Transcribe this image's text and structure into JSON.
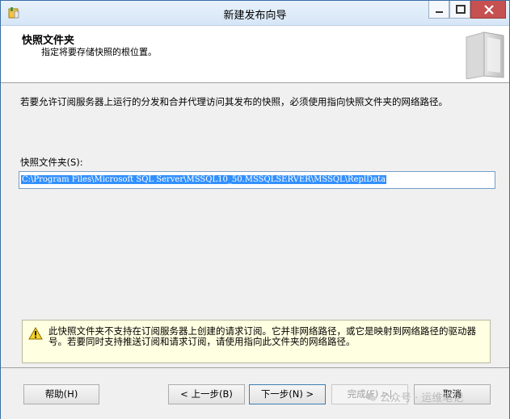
{
  "window": {
    "title": "新建发布向导"
  },
  "header": {
    "title": "快照文件夹",
    "description": "指定将要存储快照的根位置。"
  },
  "content": {
    "intro": "若要允许订阅服务器上运行的分发和合并代理访问其发布的快照，必须使用指向快照文件夹的网络路径。",
    "folder_label": "快照文件夹(S):",
    "folder_value": "C:\\Program Files\\Microsoft SQL Server\\MSSQL10_50.MSSQLSERVER\\MSSQL\\ReplData"
  },
  "warning": {
    "icon": "warning-icon",
    "text": "此快照文件夹不支持在订阅服务器上创建的请求订阅。它并非网络路径，或它是映射到网络路径的驱动器号。若要同时支持推送订阅和请求订阅，请使用指向此文件夹的网络路径。"
  },
  "buttons": {
    "help": "帮助(H)",
    "prev": "< 上一步(B)",
    "next": "下一步(N) >",
    "finish": "完成(F) >|",
    "cancel": "取消"
  },
  "watermark": {
    "text": "公众号 · 运维笔记"
  },
  "colors": {
    "accent": "#3390ff",
    "warning_bg": "#ffffe1",
    "close_button": "#c75050"
  }
}
